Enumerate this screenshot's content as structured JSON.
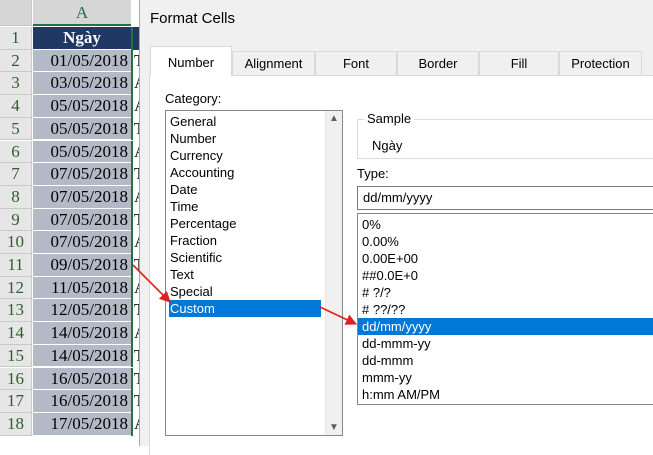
{
  "sheet": {
    "column_header": "A",
    "row_numbers": [
      "1",
      "2",
      "3",
      "4",
      "5",
      "6",
      "7",
      "8",
      "9",
      "10",
      "11",
      "12",
      "13",
      "14",
      "15",
      "16",
      "17",
      "18"
    ],
    "header_cell": "Ngày",
    "dates": [
      "01/05/2018",
      "03/05/2018",
      "05/05/2018",
      "05/05/2018",
      "05/05/2018",
      "07/05/2018",
      "07/05/2018",
      "07/05/2018",
      "07/05/2018",
      "09/05/2018",
      "11/05/2018",
      "12/05/2018",
      "14/05/2018",
      "14/05/2018",
      "16/05/2018",
      "16/05/2018",
      "17/05/2018"
    ],
    "next_col_chars": [
      "T",
      "A",
      "A",
      "T",
      "A",
      "T",
      "A",
      "T",
      "A",
      "T",
      "A",
      "T",
      "A",
      "T",
      "T",
      "T",
      "A"
    ]
  },
  "dialog": {
    "title": "Format Cells",
    "tabs": [
      "Number",
      "Alignment",
      "Font",
      "Border",
      "Fill",
      "Protection"
    ],
    "active_tab": "Number",
    "category_label": "Category:",
    "categories": [
      "General",
      "Number",
      "Currency",
      "Accounting",
      "Date",
      "Time",
      "Percentage",
      "Fraction",
      "Scientific",
      "Text",
      "Special",
      "Custom"
    ],
    "selected_category": "Custom",
    "sample_label": "Sample",
    "sample_value": "Ngày",
    "type_label": "Type:",
    "type_value": "dd/mm/yyyy",
    "type_list": [
      "0%",
      "0.00%",
      "0.00E+00",
      "##0.0E+0",
      "# ?/?",
      "# ??/??",
      "dd/mm/yyyy",
      "dd-mmm-yy",
      "dd-mmm",
      "mmm-yy",
      "h:mm AM/PM"
    ],
    "selected_type": "dd/mm/yyyy"
  },
  "colors": {
    "header_cell_bg": "#203864",
    "date_cell_bg": "#b3b9c6",
    "selection_bg": "#0078d7",
    "arrow": "#e02020",
    "excel_green": "#217346"
  }
}
